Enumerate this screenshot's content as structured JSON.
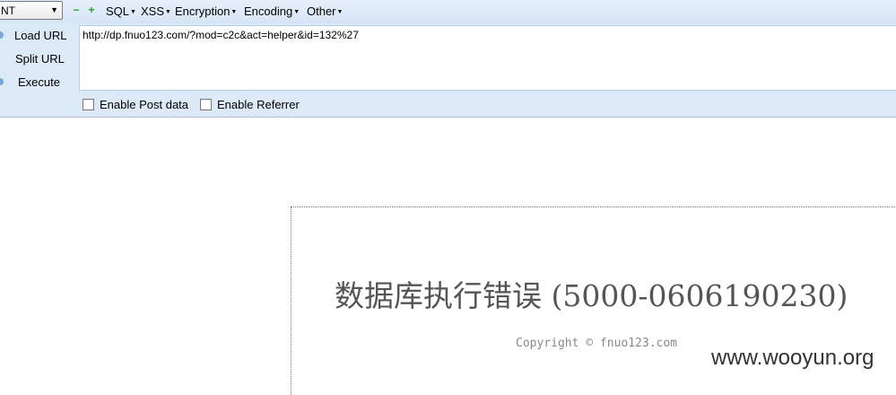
{
  "hackbar": {
    "mode_select": {
      "value": "NT"
    },
    "toolbar": {
      "minus_icon": "minus-icon",
      "plus_icon": "plus-icon",
      "menus": [
        "SQL",
        "XSS",
        "Encryption",
        "Encoding",
        "Other"
      ]
    },
    "side_buttons": {
      "load_url": "Load URL",
      "split_url": "Split URL",
      "execute": "Execute"
    },
    "url_value": "http://dp.fnuo123.com/?mod=c2c&act=helper&id=132%27",
    "checkboxes": {
      "post_data": {
        "label": "Enable Post data",
        "checked": false
      },
      "referrer": {
        "label": "Enable Referrer",
        "checked": false
      }
    }
  },
  "page": {
    "error_title": "数据库执行错误 (5000-0606190230)",
    "copyright": "Copyright © fnuo123.com"
  },
  "watermark": "www.wooyun.org"
}
